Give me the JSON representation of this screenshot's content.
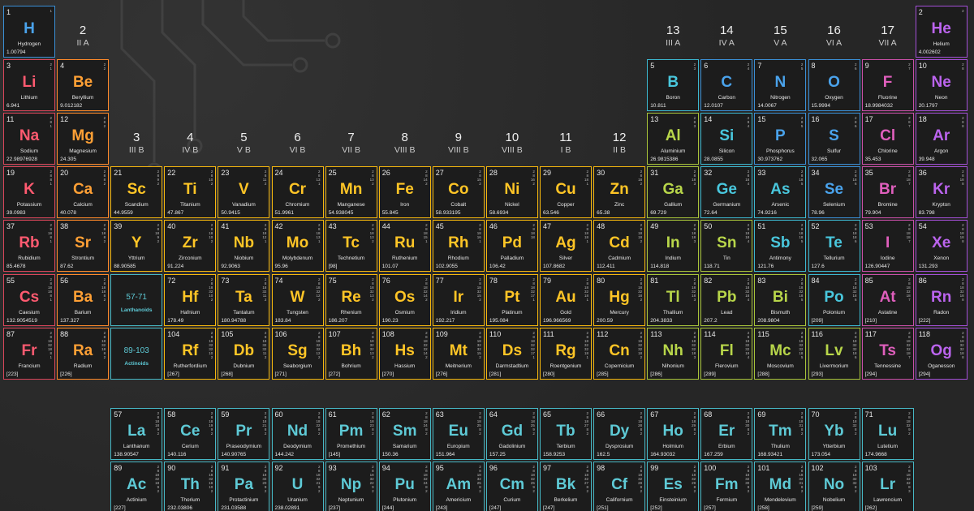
{
  "groups": [
    {
      "n": "1",
      "l": ""
    },
    {
      "n": "2",
      "l": "II A"
    },
    {
      "n": "3",
      "l": "III B"
    },
    {
      "n": "4",
      "l": "IV B"
    },
    {
      "n": "5",
      "l": "V B"
    },
    {
      "n": "6",
      "l": "VI B"
    },
    {
      "n": "7",
      "l": "VII B"
    },
    {
      "n": "8",
      "l": "VIII B"
    },
    {
      "n": "9",
      "l": "VIII B"
    },
    {
      "n": "10",
      "l": "VIII B"
    },
    {
      "n": "11",
      "l": "I B"
    },
    {
      "n": "12",
      "l": "II B"
    },
    {
      "n": "13",
      "l": "III A"
    },
    {
      "n": "14",
      "l": "IV A"
    },
    {
      "n": "15",
      "l": "V A"
    },
    {
      "n": "16",
      "l": "VI A"
    },
    {
      "n": "17",
      "l": "VII A"
    },
    {
      "n": "18",
      "l": ""
    }
  ],
  "placeholders": [
    {
      "range": "57-71",
      "label": "Lanthanoids"
    },
    {
      "range": "89-103",
      "label": "Actinoids"
    }
  ],
  "category_colors": {
    "alkali_metal": "#ff5a70",
    "alkaline_earth": "#ffa035",
    "transition_metal": "#ffc526",
    "post_transition_metal": "#b8d64a",
    "metalloid": "#49c7dd",
    "nonmetal": "#4aa3ec",
    "halogen": "#e05fbd",
    "noble_gas": "#bb64ee",
    "lanthanide_actinide": "#5ecad6"
  },
  "elements": [
    {
      "n": 1,
      "s": "H",
      "name": "Hydrogen",
      "m": "1.00794",
      "c": "nm",
      "sh": "1"
    },
    {
      "n": 2,
      "s": "He",
      "name": "Helium",
      "m": "4.002602",
      "c": "ng",
      "sh": "2"
    },
    {
      "n": 3,
      "s": "Li",
      "name": "Lithium",
      "m": "6.941",
      "c": "alk",
      "sh": "2 1"
    },
    {
      "n": 4,
      "s": "Be",
      "name": "Beryllium",
      "m": "9.012182",
      "c": "ae",
      "sh": "2 2"
    },
    {
      "n": 5,
      "s": "B",
      "name": "Boron",
      "m": "10.811",
      "c": "met",
      "sh": "2 3"
    },
    {
      "n": 6,
      "s": "C",
      "name": "Carbon",
      "m": "12.0107",
      "c": "nm",
      "sh": "2 4"
    },
    {
      "n": 7,
      "s": "N",
      "name": "Nitrogen",
      "m": "14.0067",
      "c": "nm",
      "sh": "2 5"
    },
    {
      "n": 8,
      "s": "O",
      "name": "Oxygen",
      "m": "15.9994",
      "c": "nm",
      "sh": "2 6"
    },
    {
      "n": 9,
      "s": "F",
      "name": "Fluorine",
      "m": "18.9984032",
      "c": "hal",
      "sh": "2 7"
    },
    {
      "n": 10,
      "s": "Ne",
      "name": "Neon",
      "m": "20.1797",
      "c": "ng",
      "sh": "2 8"
    },
    {
      "n": 11,
      "s": "Na",
      "name": "Sodium",
      "m": "22.98976928",
      "c": "alk",
      "sh": "2 8 1"
    },
    {
      "n": 12,
      "s": "Mg",
      "name": "Magnesium",
      "m": "24.305",
      "c": "ae",
      "sh": "2 8 2"
    },
    {
      "n": 13,
      "s": "Al",
      "name": "Aluminium",
      "m": "26.9815386",
      "c": "ptm",
      "sh": "2 8 3"
    },
    {
      "n": 14,
      "s": "Si",
      "name": "Silicon",
      "m": "28.0855",
      "c": "met",
      "sh": "2 8 4"
    },
    {
      "n": 15,
      "s": "P",
      "name": "Phosphorus",
      "m": "30.973762",
      "c": "nm",
      "sh": "2 8 5"
    },
    {
      "n": 16,
      "s": "S",
      "name": "Sulfur",
      "m": "32.065",
      "c": "nm",
      "sh": "2 8 6"
    },
    {
      "n": 17,
      "s": "Cl",
      "name": "Chlorine",
      "m": "35.453",
      "c": "hal",
      "sh": "2 8 7"
    },
    {
      "n": 18,
      "s": "Ar",
      "name": "Argon",
      "m": "39.948",
      "c": "ng",
      "sh": "2 8 8"
    },
    {
      "n": 19,
      "s": "K",
      "name": "Potassium",
      "m": "39.0983",
      "c": "alk",
      "sh": "2 8 8 1"
    },
    {
      "n": 20,
      "s": "Ca",
      "name": "Calcium",
      "m": "40.078",
      "c": "ae",
      "sh": "2 8 8 2"
    },
    {
      "n": 21,
      "s": "Sc",
      "name": "Scandium",
      "m": "44.9559",
      "c": "tm",
      "sh": "2 8 9 2"
    },
    {
      "n": 22,
      "s": "Ti",
      "name": "Titanium",
      "m": "47.867",
      "c": "tm",
      "sh": "2 8 10 2"
    },
    {
      "n": 23,
      "s": "V",
      "name": "Vanadium",
      "m": "50.9415",
      "c": "tm",
      "sh": "2 8 11 2"
    },
    {
      "n": 24,
      "s": "Cr",
      "name": "Chromium",
      "m": "51.9961",
      "c": "tm",
      "sh": "2 8 13 1"
    },
    {
      "n": 25,
      "s": "Mn",
      "name": "Manganese",
      "m": "54.938045",
      "c": "tm",
      "sh": "2 8 13 2"
    },
    {
      "n": 26,
      "s": "Fe",
      "name": "Iron",
      "m": "55.845",
      "c": "tm",
      "sh": "2 8 14 2"
    },
    {
      "n": 27,
      "s": "Co",
      "name": "Cobalt",
      "m": "58.933195",
      "c": "tm",
      "sh": "2 8 15 2"
    },
    {
      "n": 28,
      "s": "Ni",
      "name": "Nickel",
      "m": "58.6934",
      "c": "tm",
      "sh": "2 8 16 2"
    },
    {
      "n": 29,
      "s": "Cu",
      "name": "Copper",
      "m": "63.546",
      "c": "tm",
      "sh": "2 8 18 1"
    },
    {
      "n": 30,
      "s": "Zn",
      "name": "Zinc",
      "m": "65.38",
      "c": "tm",
      "sh": "2 8 18 2"
    },
    {
      "n": 31,
      "s": "Ga",
      "name": "Gallium",
      "m": "69.729",
      "c": "ptm",
      "sh": "2 8 18 3"
    },
    {
      "n": 32,
      "s": "Ge",
      "name": "Germanium",
      "m": "72.64",
      "c": "met",
      "sh": "2 8 18 4"
    },
    {
      "n": 33,
      "s": "As",
      "name": "Arsenic",
      "m": "74.9216",
      "c": "met",
      "sh": "2 8 18 5"
    },
    {
      "n": 34,
      "s": "Se",
      "name": "Selenium",
      "m": "78.96",
      "c": "nm",
      "sh": "2 8 18 6"
    },
    {
      "n": 35,
      "s": "Br",
      "name": "Bromine",
      "m": "79.904",
      "c": "hal",
      "sh": "2 8 18 7"
    },
    {
      "n": 36,
      "s": "Kr",
      "name": "Krypton",
      "m": "83.798",
      "c": "ng",
      "sh": "2 8 18 8"
    },
    {
      "n": 37,
      "s": "Rb",
      "name": "Rubidium",
      "m": "85.4678",
      "c": "alk",
      "sh": "2 8 18 8 1"
    },
    {
      "n": 38,
      "s": "Sr",
      "name": "Strontium",
      "m": "87.62",
      "c": "ae",
      "sh": "2 8 18 8 2"
    },
    {
      "n": 39,
      "s": "Y",
      "name": "Yttrium",
      "m": "88.90585",
      "c": "tm",
      "sh": "2 8 18 9 2"
    },
    {
      "n": 40,
      "s": "Zr",
      "name": "Zirconium",
      "m": "91.224",
      "c": "tm",
      "sh": "2 8 18 10 2"
    },
    {
      "n": 41,
      "s": "Nb",
      "name": "Niobium",
      "m": "92.9063",
      "c": "tm",
      "sh": "2 8 18 12 1"
    },
    {
      "n": 42,
      "s": "Mo",
      "name": "Molybdenum",
      "m": "95.96",
      "c": "tm",
      "sh": "2 8 18 13 1"
    },
    {
      "n": 43,
      "s": "Tc",
      "name": "Technetium",
      "m": "[98]",
      "c": "tm",
      "sh": "2 8 18 13 2"
    },
    {
      "n": 44,
      "s": "Ru",
      "name": "Ruthenium",
      "m": "101.07",
      "c": "tm",
      "sh": "2 8 18 15 1"
    },
    {
      "n": 45,
      "s": "Rh",
      "name": "Rhodium",
      "m": "102.9055",
      "c": "tm",
      "sh": "2 8 18 16 1"
    },
    {
      "n": 46,
      "s": "Pd",
      "name": "Palladium",
      "m": "106.42",
      "c": "tm",
      "sh": "2 8 18 18"
    },
    {
      "n": 47,
      "s": "Ag",
      "name": "Silver",
      "m": "107.8682",
      "c": "tm",
      "sh": "2 8 18 18 1"
    },
    {
      "n": 48,
      "s": "Cd",
      "name": "Cadmium",
      "m": "112.411",
      "c": "tm",
      "sh": "2 8 18 18 2"
    },
    {
      "n": 49,
      "s": "In",
      "name": "Indium",
      "m": "114.818",
      "c": "ptm",
      "sh": "2 8 18 18 3"
    },
    {
      "n": 50,
      "s": "Sn",
      "name": "Tin",
      "m": "118.71",
      "c": "ptm",
      "sh": "2 8 18 18 4"
    },
    {
      "n": 51,
      "s": "Sb",
      "name": "Antimony",
      "m": "121.76",
      "c": "met",
      "sh": "2 8 18 18 5"
    },
    {
      "n": 52,
      "s": "Te",
      "name": "Tellurium",
      "m": "127.6",
      "c": "met",
      "sh": "2 8 18 18 6"
    },
    {
      "n": 53,
      "s": "I",
      "name": "Iodine",
      "m": "126.90447",
      "c": "hal",
      "sh": "2 8 18 18 7"
    },
    {
      "n": 54,
      "s": "Xe",
      "name": "Xenon",
      "m": "131.293",
      "c": "ng",
      "sh": "2 8 18 18 8"
    },
    {
      "n": 55,
      "s": "Cs",
      "name": "Caesium",
      "m": "132.9054519",
      "c": "alk",
      "sh": "2 8 18 18 8 1"
    },
    {
      "n": 56,
      "s": "Ba",
      "name": "Barium",
      "m": "137.327",
      "c": "ae",
      "sh": "2 8 18 18 8 2"
    },
    {
      "n": 72,
      "s": "Hf",
      "name": "Hafnium",
      "m": "178.49",
      "c": "tm",
      "sh": "2 8 18 32 10 2"
    },
    {
      "n": 73,
      "s": "Ta",
      "name": "Tantalum",
      "m": "180.94788",
      "c": "tm",
      "sh": "2 8 18 32 11 2"
    },
    {
      "n": 74,
      "s": "W",
      "name": "Tungsten",
      "m": "183.84",
      "c": "tm",
      "sh": "2 8 18 32 12 2"
    },
    {
      "n": 75,
      "s": "Re",
      "name": "Rhenium",
      "m": "186.207",
      "c": "tm",
      "sh": "2 8 18 32 13 2"
    },
    {
      "n": 76,
      "s": "Os",
      "name": "Osmium",
      "m": "190.23",
      "c": "tm",
      "sh": "2 8 18 32 14 2"
    },
    {
      "n": 77,
      "s": "Ir",
      "name": "Iridium",
      "m": "192.217",
      "c": "tm",
      "sh": "2 8 18 32 15 2"
    },
    {
      "n": 78,
      "s": "Pt",
      "name": "Platinum",
      "m": "195.084",
      "c": "tm",
      "sh": "2 8 18 32 17 1"
    },
    {
      "n": 79,
      "s": "Au",
      "name": "Gold",
      "m": "196.966569",
      "c": "tm",
      "sh": "2 8 18 32 18 1"
    },
    {
      "n": 80,
      "s": "Hg",
      "name": "Mercury",
      "m": "200.59",
      "c": "tm",
      "sh": "2 8 18 32 18 2"
    },
    {
      "n": 81,
      "s": "Tl",
      "name": "Thallium",
      "m": "204.3833",
      "c": "ptm",
      "sh": "2 8 18 32 18 3"
    },
    {
      "n": 82,
      "s": "Pb",
      "name": "Lead",
      "m": "207.2",
      "c": "ptm",
      "sh": "2 8 18 32 18 4"
    },
    {
      "n": 83,
      "s": "Bi",
      "name": "Bismuth",
      "m": "208.9804",
      "c": "ptm",
      "sh": "2 8 18 32 18 5"
    },
    {
      "n": 84,
      "s": "Po",
      "name": "Polonium",
      "m": "[209]",
      "c": "met",
      "sh": "2 8 18 32 18 6"
    },
    {
      "n": 85,
      "s": "At",
      "name": "Astatine",
      "m": "[210]",
      "c": "hal",
      "sh": "2 8 18 32 18 7"
    },
    {
      "n": 86,
      "s": "Rn",
      "name": "Radon",
      "m": "[222]",
      "c": "ng",
      "sh": "2 8 18 32 18 8"
    },
    {
      "n": 87,
      "s": "Fr",
      "name": "Francium",
      "m": "[223]",
      "c": "alk",
      "sh": "2 8 18 32 18 8 1"
    },
    {
      "n": 88,
      "s": "Ra",
      "name": "Radium",
      "m": "[226]",
      "c": "ae",
      "sh": "2 8 18 32 18 8 2"
    },
    {
      "n": 104,
      "s": "Rf",
      "name": "Rutherfordium",
      "m": "[267]",
      "c": "tm",
      "sh": "2 8 18 32 32 10 2"
    },
    {
      "n": 105,
      "s": "Db",
      "name": "Dubnium",
      "m": "[268]",
      "c": "tm",
      "sh": "2 8 18 32 32 11 2"
    },
    {
      "n": 106,
      "s": "Sg",
      "name": "Seaborgium",
      "m": "[271]",
      "c": "tm",
      "sh": "2 8 18 32 32 12 2"
    },
    {
      "n": 107,
      "s": "Bh",
      "name": "Bohrium",
      "m": "[272]",
      "c": "tm",
      "sh": "2 8 18 32 32 13 2"
    },
    {
      "n": 108,
      "s": "Hs",
      "name": "Hassium",
      "m": "[270]",
      "c": "tm",
      "sh": "2 8 18 32 32 14 2"
    },
    {
      "n": 109,
      "s": "Mt",
      "name": "Meitnerium",
      "m": "[276]",
      "c": "tm",
      "sh": "2 8 18 32 32 15 2"
    },
    {
      "n": 110,
      "s": "Ds",
      "name": "Darmstadtium",
      "m": "[281]",
      "c": "tm",
      "sh": "2 8 18 32 32 17 1"
    },
    {
      "n": 111,
      "s": "Rg",
      "name": "Roentgenium",
      "m": "[280]",
      "c": "tm",
      "sh": "2 8 18 32 32 18 1"
    },
    {
      "n": 112,
      "s": "Cn",
      "name": "Copernicium",
      "m": "[285]",
      "c": "tm",
      "sh": "2 8 18 32 32 18 2"
    },
    {
      "n": 113,
      "s": "Nh",
      "name": "Nihonium",
      "m": "[286]",
      "c": "ptm",
      "sh": "2 8 18 32 32 18 3"
    },
    {
      "n": 114,
      "s": "Fl",
      "name": "Flerovium",
      "m": "[289]",
      "c": "ptm",
      "sh": "2 8 18 32 32 18 4"
    },
    {
      "n": 115,
      "s": "Mc",
      "name": "Moscovium",
      "m": "[288]",
      "c": "ptm",
      "sh": "2 8 18 32 32 18 5"
    },
    {
      "n": 116,
      "s": "Lv",
      "name": "Livermorium",
      "m": "[293]",
      "c": "ptm",
      "sh": "2 8 18 32 32 18 6"
    },
    {
      "n": 117,
      "s": "Ts",
      "name": "Tennessine",
      "m": "[294]",
      "c": "hal",
      "sh": "2 8 18 32 32 18 7"
    },
    {
      "n": 118,
      "s": "Og",
      "name": "Oganesson",
      "m": "[294]",
      "c": "ng",
      "sh": "2 8 18 32 32 18 8"
    },
    {
      "n": 57,
      "s": "La",
      "name": "Lanthanum",
      "m": "138.90547",
      "c": "lan",
      "sh": "2 8 18 18 9 2"
    },
    {
      "n": 58,
      "s": "Ce",
      "name": "Cerium",
      "m": "140.116",
      "c": "lan",
      "sh": "2 8 18 19 9 2"
    },
    {
      "n": 59,
      "s": "Pr",
      "name": "Praseodymium",
      "m": "140.90765",
      "c": "lan",
      "sh": "2 8 18 21 8 2"
    },
    {
      "n": 60,
      "s": "Nd",
      "name": "Deodymium",
      "m": "144.242",
      "c": "lan",
      "sh": "2 8 18 22 8 2"
    },
    {
      "n": 61,
      "s": "Pm",
      "name": "Promethium",
      "m": "[145]",
      "c": "lan",
      "sh": "2 8 18 23 8 2"
    },
    {
      "n": 62,
      "s": "Sm",
      "name": "Samarium",
      "m": "150.36",
      "c": "lan",
      "sh": "2 8 18 24 8 2"
    },
    {
      "n": 63,
      "s": "Eu",
      "name": "Europium",
      "m": "151.964",
      "c": "lan",
      "sh": "2 8 18 25 8 2"
    },
    {
      "n": 64,
      "s": "Gd",
      "name": "Gadolinium",
      "m": "157.25",
      "c": "lan",
      "sh": "2 8 18 25 9 2"
    },
    {
      "n": 65,
      "s": "Tb",
      "name": "Terbium",
      "m": "158.9253",
      "c": "lan",
      "sh": "2 8 18 27 8 2"
    },
    {
      "n": 66,
      "s": "Dy",
      "name": "Dysprosium",
      "m": "162.5",
      "c": "lan",
      "sh": "2 8 18 28 8 2"
    },
    {
      "n": 67,
      "s": "Ho",
      "name": "Holmium",
      "m": "164.93032",
      "c": "lan",
      "sh": "2 8 18 29 8 2"
    },
    {
      "n": 68,
      "s": "Er",
      "name": "Erbium",
      "m": "167.259",
      "c": "lan",
      "sh": "2 8 18 30 8 2"
    },
    {
      "n": 69,
      "s": "Tm",
      "name": "Thulium",
      "m": "168.93421",
      "c": "lan",
      "sh": "2 8 18 31 8 2"
    },
    {
      "n": 70,
      "s": "Yb",
      "name": "Ytterbium",
      "m": "173.054",
      "c": "lan",
      "sh": "2 8 18 32 8 2"
    },
    {
      "n": 71,
      "s": "Lu",
      "name": "Lutetium",
      "m": "174.9668",
      "c": "lan",
      "sh": "2 8 18 32 9 2"
    },
    {
      "n": 89,
      "s": "Ac",
      "name": "Actinium",
      "m": "[227]",
      "c": "lan",
      "sh": "2 8 18 32 18 9 2"
    },
    {
      "n": 90,
      "s": "Th",
      "name": "Thorium",
      "m": "232.03806",
      "c": "lan",
      "sh": "2 8 18 32 18 10 2"
    },
    {
      "n": 91,
      "s": "Pa",
      "name": "Protactinium",
      "m": "231.03588",
      "c": "lan",
      "sh": "2 8 18 32 20 9 2"
    },
    {
      "n": 92,
      "s": "U",
      "name": "Uranium",
      "m": "238.02891",
      "c": "lan",
      "sh": "2 8 18 32 21 9 2"
    },
    {
      "n": 93,
      "s": "Np",
      "name": "Neptunium",
      "m": "[237]",
      "c": "lan",
      "sh": "2 8 18 32 22 9 2"
    },
    {
      "n": 94,
      "s": "Pu",
      "name": "Plutonium",
      "m": "[244]",
      "c": "lan",
      "sh": "2 8 18 32 24 8 2"
    },
    {
      "n": 95,
      "s": "Am",
      "name": "Americium",
      "m": "[243]",
      "c": "lan",
      "sh": "2 8 18 32 25 8 2"
    },
    {
      "n": 96,
      "s": "Cm",
      "name": "Curium",
      "m": "[247]",
      "c": "lan",
      "sh": "2 8 18 32 25 9 2"
    },
    {
      "n": 97,
      "s": "Bk",
      "name": "Berkelium",
      "m": "[247]",
      "c": "lan",
      "sh": "2 8 18 32 27 8 2"
    },
    {
      "n": 98,
      "s": "Cf",
      "name": "Californium",
      "m": "[251]",
      "c": "lan",
      "sh": "2 8 18 32 28 8 2"
    },
    {
      "n": 99,
      "s": "Es",
      "name": "Einsteinium",
      "m": "[252]",
      "c": "lan",
      "sh": "2 8 18 32 29 8 2"
    },
    {
      "n": 100,
      "s": "Fm",
      "name": "Fermium",
      "m": "[257]",
      "c": "lan",
      "sh": "2 8 18 32 30 8 2"
    },
    {
      "n": 101,
      "s": "Md",
      "name": "Mendelevium",
      "m": "[258]",
      "c": "lan",
      "sh": "2 8 18 32 31 8 2"
    },
    {
      "n": 102,
      "s": "No",
      "name": "Nobelium",
      "m": "[259]",
      "c": "lan",
      "sh": "2 8 18 32 32 8 2"
    },
    {
      "n": 103,
      "s": "Lr",
      "name": "Lawrencium",
      "m": "[262]",
      "c": "lan",
      "sh": "2 8 18 32 32 8 3"
    }
  ]
}
